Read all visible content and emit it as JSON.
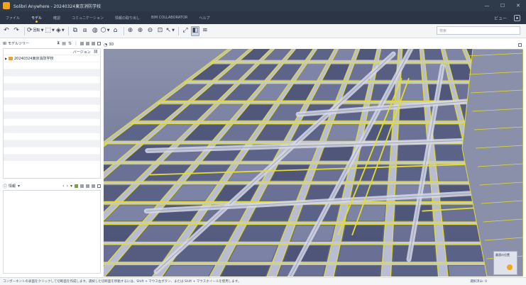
{
  "titlebar": {
    "title": "Solibri Anywhere - 20240324東京消防学校",
    "minimize_glyph": "—",
    "maximize_glyph": "☐",
    "close_glyph": "✕"
  },
  "ribbon": {
    "tabs": [
      "ファイル",
      "モデル",
      "確認",
      "コミュニケーション",
      "情報の取り出し",
      "BIM COLLABORATOR",
      "ヘルプ"
    ],
    "active_tab": "モデル",
    "right_items": [
      "ビュー"
    ]
  },
  "toolbar": {
    "orbit_label": "回転",
    "search_placeholder": "検索"
  },
  "left_panel": {
    "model_tree_title": "モデルツリー",
    "version_label": "バージョン",
    "tree_items": [
      "20240324東京消防学校"
    ],
    "info_title": "情報"
  },
  "view": {
    "title": "3D"
  },
  "nav_cube": {
    "label": "最適の位置"
  },
  "status": {
    "hint": "コンポーネントの表面をクリックして切断面を作成します。選択した切断面を移動するには、Shift + マウス左ボタン、または Shift + マウスホイールを使用します。",
    "selection": "選択済み: 0"
  },
  "colors": {
    "titlebar": "#2f3a4a",
    "ribbon": "#2b3546",
    "view_background": "#6e7694",
    "highlight_yellow": "#e4dd2c",
    "accent_orange": "#f0a81c"
  }
}
